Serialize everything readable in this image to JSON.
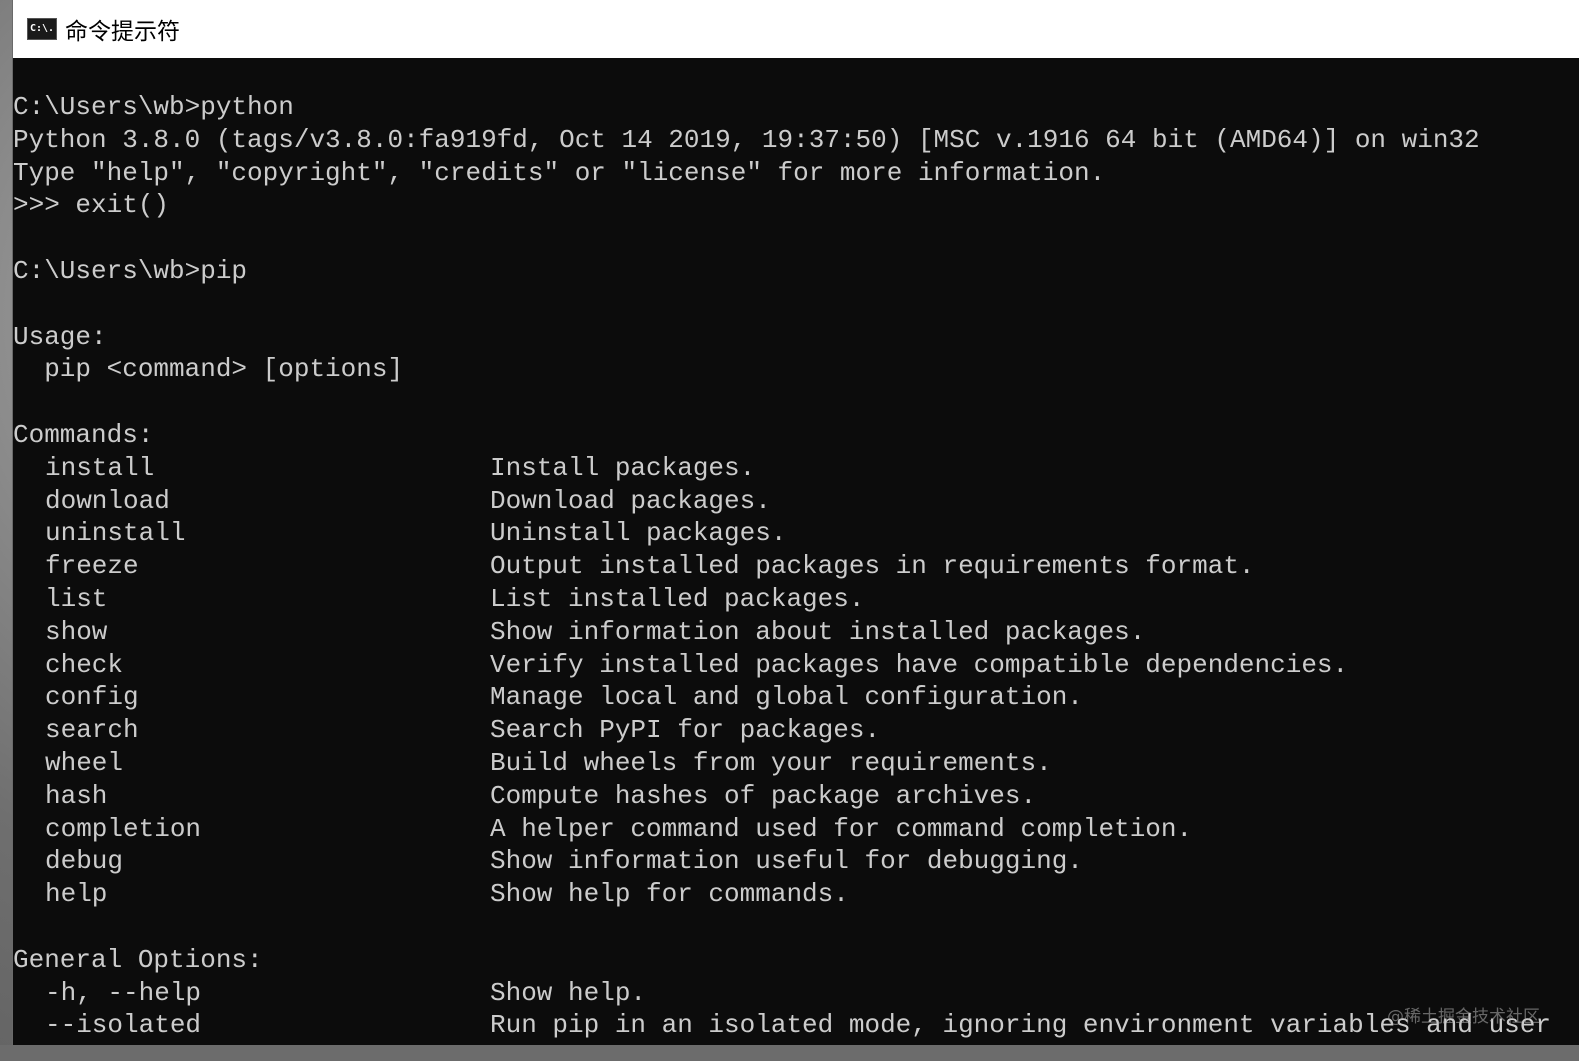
{
  "window": {
    "title": "命令提示符",
    "icon_label": "C:\\."
  },
  "console": {
    "intro_lines": [
      "C:\\Users\\wb>python",
      "Python 3.8.0 (tags/v3.8.0:fa919fd, Oct 14 2019, 19:37:50) [MSC v.1916 64 bit (AMD64)] on win32",
      "Type \"help\", \"copyright\", \"credits\" or \"license\" for more information.",
      ">>> exit()",
      "",
      "C:\\Users\\wb>pip",
      "",
      "Usage:",
      "  pip <command> [options]",
      "",
      "Commands:"
    ],
    "commands": [
      {
        "name": "install",
        "desc": "Install packages."
      },
      {
        "name": "download",
        "desc": "Download packages."
      },
      {
        "name": "uninstall",
        "desc": "Uninstall packages."
      },
      {
        "name": "freeze",
        "desc": "Output installed packages in requirements format."
      },
      {
        "name": "list",
        "desc": "List installed packages."
      },
      {
        "name": "show",
        "desc": "Show information about installed packages."
      },
      {
        "name": "check",
        "desc": "Verify installed packages have compatible dependencies."
      },
      {
        "name": "config",
        "desc": "Manage local and global configuration."
      },
      {
        "name": "search",
        "desc": "Search PyPI for packages."
      },
      {
        "name": "wheel",
        "desc": "Build wheels from your requirements."
      },
      {
        "name": "hash",
        "desc": "Compute hashes of package archives."
      },
      {
        "name": "completion",
        "desc": "A helper command used for command completion."
      },
      {
        "name": "debug",
        "desc": "Show information useful for debugging."
      },
      {
        "name": "help",
        "desc": "Show help for commands."
      }
    ],
    "general_options_header": "General Options:",
    "general_options": [
      {
        "name": "-h, --help",
        "desc": "Show help."
      },
      {
        "name": "--isolated",
        "desc": "Run pip in an isolated mode, ignoring environment variables and user"
      }
    ]
  },
  "watermark": "@稀土掘金技术社区",
  "colors": {
    "console_bg": "#0c0c0c",
    "console_fg": "#cccccc",
    "titlebar_bg": "#ffffff"
  }
}
